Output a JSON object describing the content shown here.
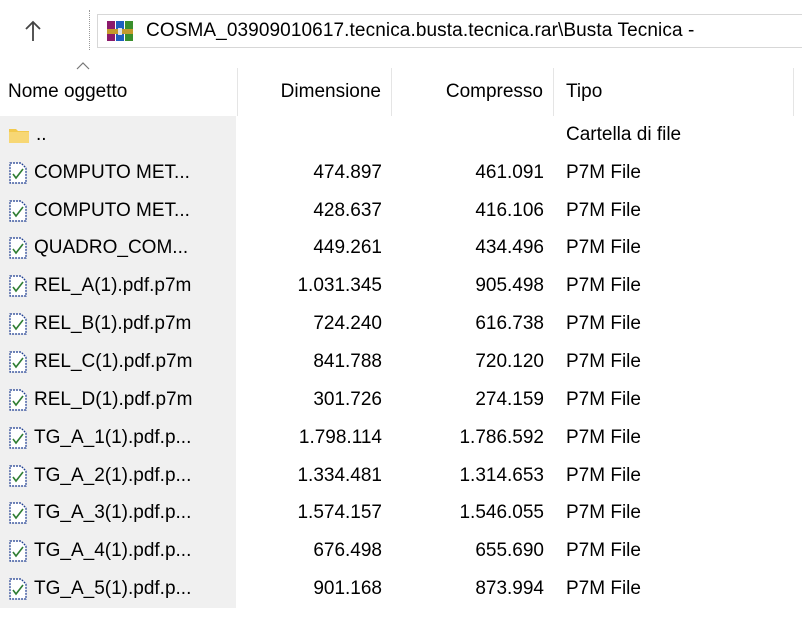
{
  "toolbar": {
    "up_icon": "arrow-up-icon",
    "archive_icon": "winrar-archive-icon",
    "address_path": "COSMA_03909010617.tecnica.busta.tecnica.rar\\Busta Tecnica -"
  },
  "columns": {
    "name": "Nome oggetto",
    "size": "Dimensione",
    "compressed": "Compresso",
    "type": "Tipo"
  },
  "rows": [
    {
      "icon": "folder-icon",
      "name": "..",
      "size": "",
      "compressed": "",
      "type": "Cartella di file"
    },
    {
      "icon": "signed-file-icon",
      "name": "COMPUTO MET...",
      "size": "474.897",
      "compressed": "461.091",
      "type": "P7M File"
    },
    {
      "icon": "signed-file-icon",
      "name": "COMPUTO MET...",
      "size": "428.637",
      "compressed": "416.106",
      "type": "P7M File"
    },
    {
      "icon": "signed-file-icon",
      "name": "QUADRO_COM...",
      "size": "449.261",
      "compressed": "434.496",
      "type": "P7M File"
    },
    {
      "icon": "signed-file-icon",
      "name": "REL_A(1).pdf.p7m",
      "size": "1.031.345",
      "compressed": "905.498",
      "type": "P7M File"
    },
    {
      "icon": "signed-file-icon",
      "name": "REL_B(1).pdf.p7m",
      "size": "724.240",
      "compressed": "616.738",
      "type": "P7M File"
    },
    {
      "icon": "signed-file-icon",
      "name": "REL_C(1).pdf.p7m",
      "size": "841.788",
      "compressed": "720.120",
      "type": "P7M File"
    },
    {
      "icon": "signed-file-icon",
      "name": "REL_D(1).pdf.p7m",
      "size": "301.726",
      "compressed": "274.159",
      "type": "P7M File"
    },
    {
      "icon": "signed-file-icon",
      "name": "TG_A_1(1).pdf.p...",
      "size": "1.798.114",
      "compressed": "1.786.592",
      "type": "P7M File"
    },
    {
      "icon": "signed-file-icon",
      "name": "TG_A_2(1).pdf.p...",
      "size": "1.334.481",
      "compressed": "1.314.653",
      "type": "P7M File"
    },
    {
      "icon": "signed-file-icon",
      "name": "TG_A_3(1).pdf.p...",
      "size": "1.574.157",
      "compressed": "1.546.055",
      "type": "P7M File"
    },
    {
      "icon": "signed-file-icon",
      "name": "TG_A_4(1).pdf.p...",
      "size": "676.498",
      "compressed": "655.690",
      "type": "P7M File"
    },
    {
      "icon": "signed-file-icon",
      "name": "TG_A_5(1).pdf.p...",
      "size": "901.168",
      "compressed": "873.994",
      "type": "P7M File"
    }
  ],
  "colors": {
    "name_column_bg": "#f0f0f0",
    "folder": "#f2c94c",
    "signed_file_check": "#2e7d32",
    "signed_file_border": "#1a3a8f"
  }
}
